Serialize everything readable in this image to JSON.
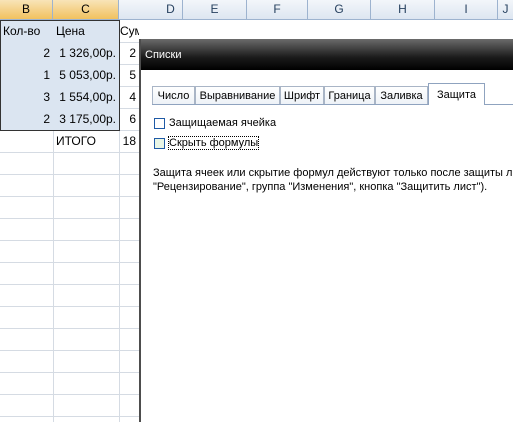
{
  "columns": [
    "B",
    "C",
    "D",
    "E",
    "F",
    "G",
    "H",
    "I",
    "J"
  ],
  "table": {
    "headers": {
      "qty": "Кол-во",
      "price": "Цена",
      "sum_partial": "Сум"
    },
    "rows": [
      {
        "qty": "2",
        "price": "1 326,00р.",
        "sum": "2"
      },
      {
        "qty": "1",
        "price": "5 053,00р.",
        "sum": "5"
      },
      {
        "qty": "3",
        "price": "1 554,00р.",
        "sum": "4"
      },
      {
        "qty": "2",
        "price": "3 175,00р.",
        "sum": "6"
      }
    ],
    "total_label": "ИТОГО",
    "total_value": "18"
  },
  "dialog": {
    "title": "Списки",
    "tabs": [
      "Число",
      "Выравнивание",
      "Шрифт",
      "Граница",
      "Заливка",
      "Защита"
    ],
    "active_tab": "Защита",
    "checkbox_locked": "Защищаемая ячейка",
    "checkbox_hidden": "Скрыть формулы",
    "note_line1": "Защита ячеек или скрытие формул действуют только после защиты листа (",
    "note_line2": "\"Рецензирование\", группа \"Изменения\", кнопка \"Защитить лист\")."
  }
}
